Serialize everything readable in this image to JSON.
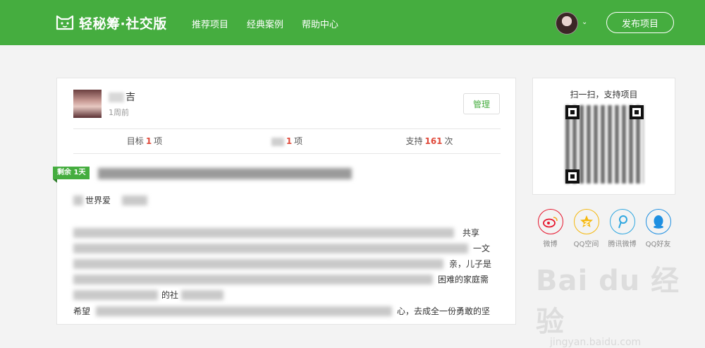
{
  "header": {
    "brand": "轻秘筹·社交版",
    "nav": [
      "推荐项目",
      "经典案例",
      "帮助中心"
    ],
    "avatar_caret": "⌄",
    "publish_label": "发布项目"
  },
  "post": {
    "author_suffix": "吉",
    "time": "1周前",
    "manage_label": "管理",
    "stats": {
      "target_prefix": "目标",
      "target_value": "1",
      "target_unit": "项",
      "done_value": "1",
      "done_unit": "项",
      "support_prefix": "支持",
      "support_value": "161",
      "support_unit": "次"
    },
    "days_left_label": "剩余 1天",
    "greeting_visible": "世界爱",
    "line3_visible": "共享",
    "line4_visible": "一文",
    "line5_visible": "亲，儿子是",
    "line6_visible": "困难的家庭需",
    "line7_visible": "的社",
    "line8_start": "希望",
    "line8_end": "心，去成全一份勇敢的坚"
  },
  "sidebar": {
    "qr_title": "扫一扫，支持项目",
    "share": [
      {
        "label": "微博",
        "icon": "weibo-icon",
        "color": "#e6162d"
      },
      {
        "label": "QQ空间",
        "icon": "qzone-icon",
        "color": "#f5b80f"
      },
      {
        "label": "腾讯微博",
        "icon": "tencent-weibo-icon",
        "color": "#2fa7e0"
      },
      {
        "label": "QQ好友",
        "icon": "qq-icon",
        "color": "#1e8fe1"
      }
    ]
  },
  "watermark": {
    "brand": "Bai du 经验",
    "url": "jingyan.baidu.com"
  }
}
